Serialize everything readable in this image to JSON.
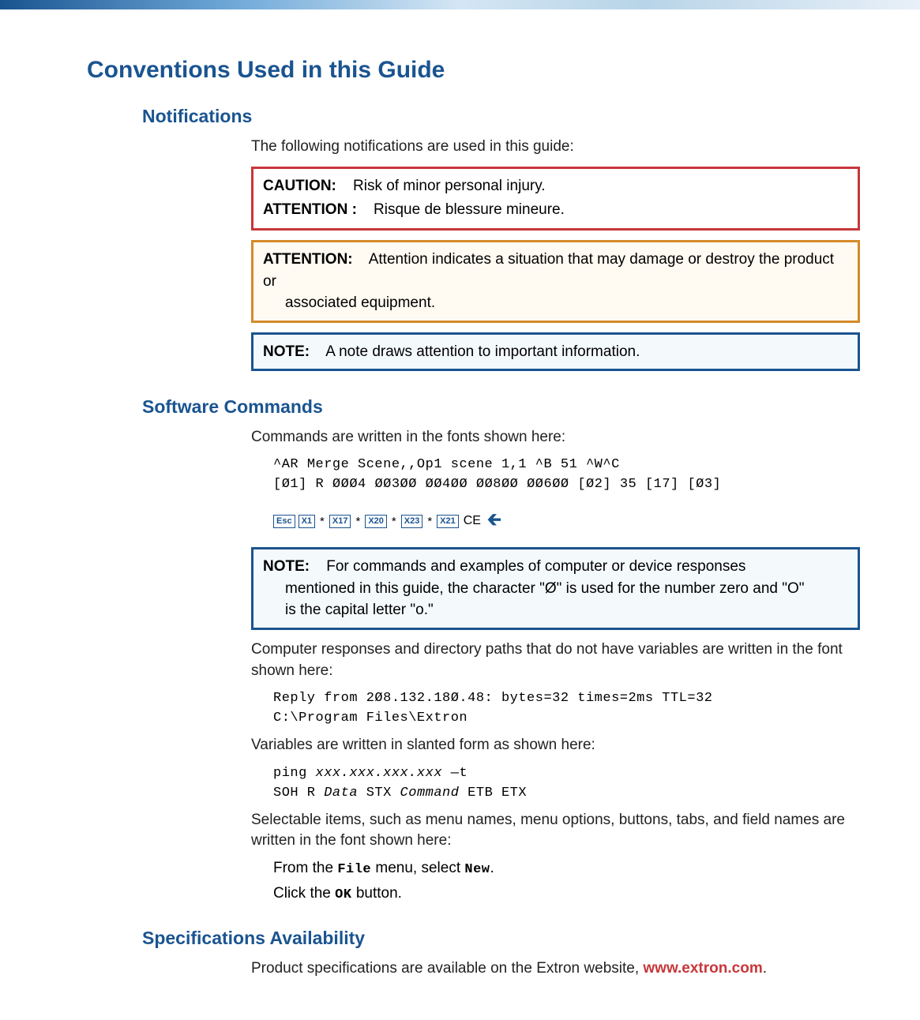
{
  "section": {
    "title": "Conventions Used in this Guide"
  },
  "notifications": {
    "heading": "Notifications",
    "intro": "The following notifications are used in this guide:",
    "caution_box": {
      "line1_label": "CAUTION:",
      "line1_text": "Risk of minor personal injury.",
      "line2_label": "ATTENTION :",
      "line2_text": "Risque de blessure mineure."
    },
    "attention_box": {
      "label": "ATTENTION:",
      "text_start": "Attention indicates a situation that may damage or destroy the product or",
      "text_cont": "associated equipment."
    },
    "note_box": {
      "label": "NOTE:",
      "text": "A note draws attention to important information."
    }
  },
  "software": {
    "heading": "Software Commands",
    "intro": "Commands are written in the fonts shown here:",
    "cmd_line1_a": "^AR",
    "cmd_line1_b": "Merge Scene,,Op1 scene 1,1",
    "cmd_line1_c": "^B",
    "cmd_line1_d": "51",
    "cmd_line1_e": "^W^C",
    "cmd_line2_a": "[Ø1]",
    "cmd_line2_b": "R",
    "cmd_line2_c": "ØØØ4",
    "cmd_line2_d": "ØØ3ØØ",
    "cmd_line2_e": "ØØ4ØØ",
    "cmd_line2_f": "ØØ8ØØ",
    "cmd_line2_g": "ØØ6ØØ",
    "cmd_line2_h": "[Ø2]",
    "cmd_line2_i": "35",
    "cmd_line2_j": "[17]",
    "cmd_line2_k": "[Ø3]",
    "keys": {
      "esc": "Esc",
      "x1": "X1",
      "x17": "X17",
      "x20": "X20",
      "x23": "X23",
      "x21": "X21",
      "star": "*",
      "ce": "CE",
      "arrow": "🡰"
    },
    "note2": {
      "label": "NOTE:",
      "text_start": "For commands and examples of computer or device responses",
      "text_cont1": "mentioned in this guide, the character \"Ø\" is used for the number zero and \"O\"",
      "text_cont2": "is the capital letter \"o.\""
    },
    "resp_intro": "Computer responses and directory paths that do not have variables are written in the font shown here:",
    "resp_line1": "Reply from 2Ø8.132.18Ø.48: bytes=32 times=2ms TTL=32",
    "resp_line2": "C:\\Program Files\\Extron",
    "var_intro": "Variables are written in slanted form as shown here:",
    "var_line1_a": "ping ",
    "var_line1_b": "xxx.xxx.xxx.xxx",
    "var_line1_c": " —t",
    "var_line2_a": "SOH R ",
    "var_line2_b": "Data",
    "var_line2_c": " STX ",
    "var_line2_d": "Command",
    "var_line2_e": " ETB ETX",
    "sel_intro": "Selectable items, such as menu names, menu options, buttons, tabs, and field names are written in the font shown here:",
    "sel_ex1_a": "From the ",
    "sel_ex1_b": "File",
    "sel_ex1_c": " menu, select ",
    "sel_ex1_d": "New",
    "sel_ex1_e": ".",
    "sel_ex2_a": "Click the ",
    "sel_ex2_b": "OK",
    "sel_ex2_c": " button."
  },
  "specs": {
    "heading": "Specifications Availability",
    "text_a": "Product specifications are available on the Extron website, ",
    "link": "www.extron.com",
    "text_b": "."
  }
}
